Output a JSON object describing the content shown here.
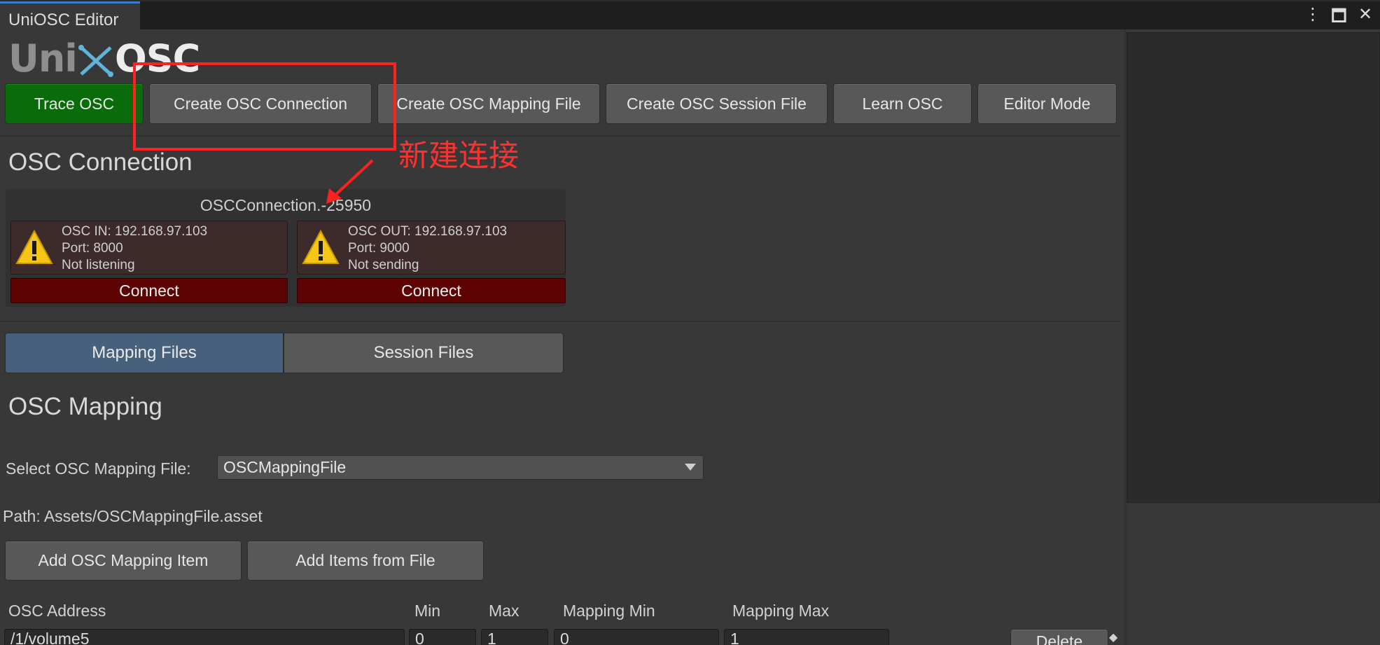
{
  "window": {
    "tab_title": "UniOSC Editor"
  },
  "logo": {
    "part1": "Uni",
    "part2": "OSC"
  },
  "toolbar": {
    "buttons": [
      "Trace OSC",
      "Create OSC Connection",
      "Create OSC Mapping File",
      "Create OSC Session File",
      "Learn OSC",
      "Editor Mode"
    ]
  },
  "annotation": {
    "label": "新建连接",
    "color": "#ff2020"
  },
  "connection": {
    "heading": "OSC Connection",
    "name": "OSCConnection.-25950",
    "in": {
      "line1": "OSC IN: 192.168.97.103",
      "line2": "Port: 8000",
      "line3": "Not listening",
      "button": "Connect"
    },
    "out": {
      "line1": "OSC OUT: 192.168.97.103",
      "line2": "Port: 9000",
      "line3": "Not sending",
      "button": "Connect"
    }
  },
  "tabs": {
    "mapping": "Mapping Files",
    "session": "Session Files",
    "active": "Mapping Files"
  },
  "mapping": {
    "heading": "OSC Mapping",
    "select_label": "Select OSC Mapping File:",
    "select_value": "OSCMappingFile",
    "path": "Path: Assets/OSCMappingFile.asset",
    "add_item": "Add OSC Mapping Item",
    "add_from_file": "Add Items from File",
    "columns": [
      "OSC Address",
      "Min",
      "Max",
      "Mapping Min",
      "Mapping Max"
    ],
    "rows": [
      {
        "address": "/1/volume5",
        "min": "0",
        "max": "1",
        "mapping_min": "0",
        "mapping_max": "1",
        "delete": "Delete"
      }
    ]
  },
  "colors": {
    "accent_tab": "#47617d",
    "trace_button": "#0a6b0a",
    "connect_button": "#5e0303",
    "warning": "#f5c518"
  }
}
